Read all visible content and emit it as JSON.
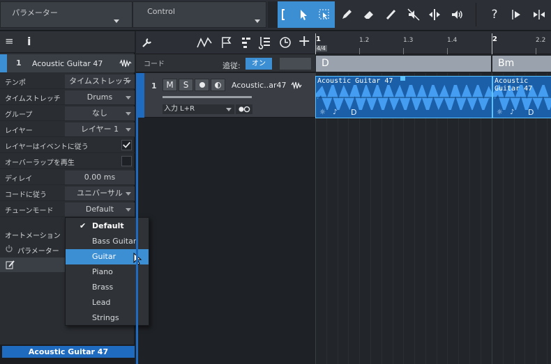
{
  "toolbar": {
    "parameter_label": "パラメーター",
    "control_label": "Control",
    "tools": [
      "bracket-tool-icon",
      "arrow-tool-icon",
      "range-tool-icon",
      "pencil-icon",
      "eraser-icon",
      "paint-icon",
      "mute-tool-icon",
      "split-tool-icon",
      "listen-icon",
      "help-icon",
      "forward-icon",
      "bend-icon"
    ]
  },
  "inspector": {
    "track_number": "1",
    "track_name": "Acoustic Guitar 47",
    "rows": [
      {
        "key": "テンポ",
        "value": "タイムストレッチ"
      },
      {
        "key": "タイムストレッチ",
        "value": "Drums"
      },
      {
        "key": "グループ",
        "value": "なし"
      },
      {
        "key": "レイヤー",
        "value": "レイヤー 1"
      },
      {
        "key": "レイヤーはイベントに従う",
        "checked": true
      },
      {
        "key": "オーバーラップを再生",
        "checked": false
      },
      {
        "key": "ディレイ",
        "value": "0.00 ms"
      },
      {
        "key": "コードに従う",
        "value": "ユニバーサル"
      },
      {
        "key": "チューンモード",
        "value": "Default"
      }
    ],
    "automation_label": "オートメーション",
    "parameter_label": "パラメーター",
    "footer_name": "Acoustic Guitar 47"
  },
  "tune_mode_menu": {
    "items": [
      "Default",
      "Bass Guitar",
      "Guitar",
      "Piano",
      "Brass",
      "Lead",
      "Strings"
    ],
    "checked": "Default",
    "highlighted": "Guitar"
  },
  "arranger": {
    "chord_track_label": "コード",
    "follow_label": "追従:",
    "follow_value": "オン",
    "time_signature": "4/4",
    "ruler_marks": [
      "1",
      "1.2",
      "1.3",
      "1.4",
      "2",
      "2.2"
    ],
    "chords": [
      "D",
      "Bm"
    ],
    "track": {
      "number": "1",
      "name": "Acoustic..ar47",
      "mute": "M",
      "solo": "S",
      "input": "入力 L+R"
    },
    "events": [
      {
        "name": "Acoustic Guitar 47",
        "chord": "D"
      },
      {
        "name": "Acoustic Guitar 47",
        "chord": "D"
      }
    ]
  }
}
